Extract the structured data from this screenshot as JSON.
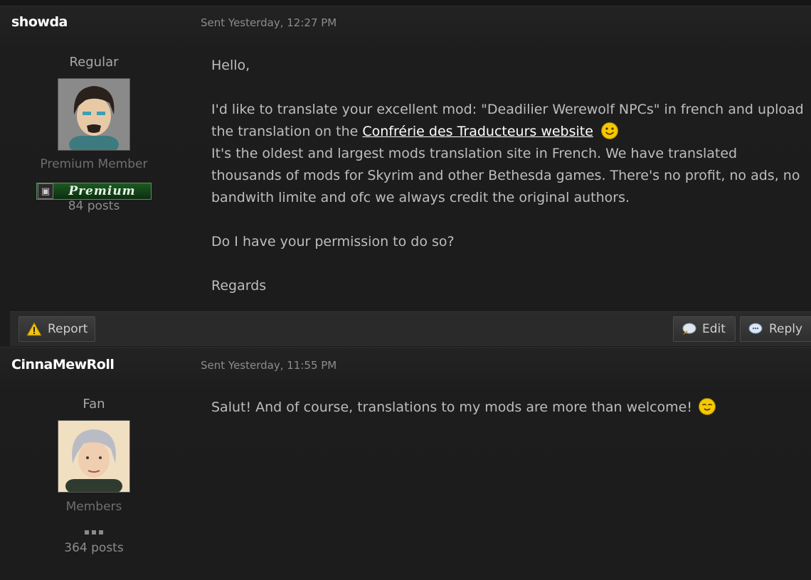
{
  "posts": [
    {
      "author": "showda",
      "sent": "Sent Yesterday, 12:27 PM",
      "rank": "Regular",
      "group": "Premium Member",
      "badge": "Premium",
      "post_count": "84 posts",
      "content": {
        "greeting": "Hello,",
        "line1": "I'd like to translate your excellent mod: \"Deadilier Werewolf NPCs\" in french and upload",
        "line2_prefix": "the translation on the ",
        "link": "Confrérie des Traducteurs website",
        "line3": "It's the oldest and largest mods translation site in French. We have translated",
        "line4": "thousands of mods for Skyrim and other Bethesda games. There's no profit, no ads, no",
        "line5": "bandwith limite and ofc we always credit the original authors.",
        "question": "Do I have your permission to do so?",
        "closing": "Regards"
      },
      "actions": {
        "report": "Report",
        "edit": "Edit",
        "reply": "Reply"
      }
    },
    {
      "author": "CinnaMewRoll",
      "sent": "Sent Yesterday, 11:55 PM",
      "rank": "Fan",
      "group": "Members",
      "post_count": "364 posts",
      "content": {
        "text": "Salut! And of course, translations to my mods are more than welcome!"
      }
    }
  ],
  "icons": {
    "report": "warning-icon",
    "edit": "edit-icon",
    "reply": "reply-icon",
    "smiley1": "smiley-icon",
    "smiley2": "content-smiley-icon"
  },
  "colors": {
    "background": "#1c1c1c",
    "author": "#ffffff",
    "link": "#ffffff",
    "badge": "#1c5a22"
  }
}
